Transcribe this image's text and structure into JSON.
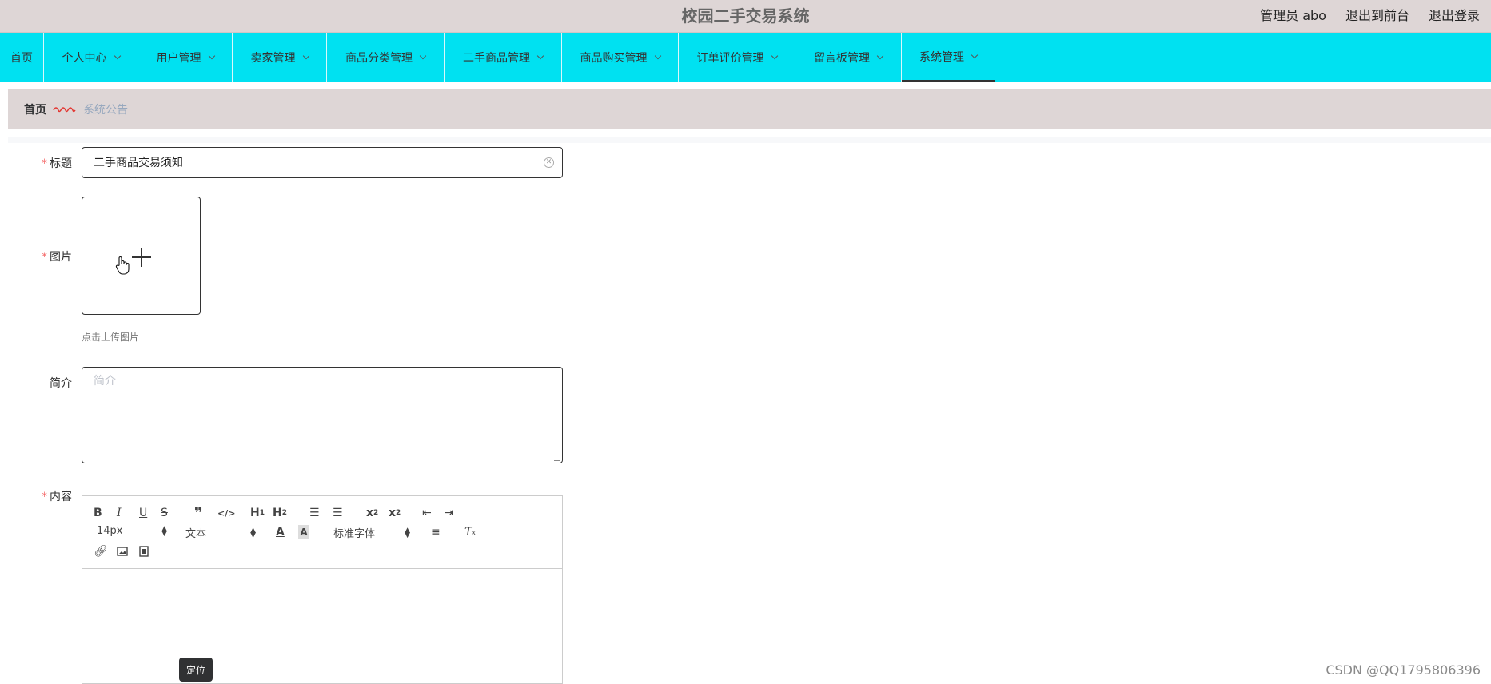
{
  "header": {
    "title": "校园二手交易系统",
    "user_label": "管理员 abo",
    "front_label": "退出到前台",
    "logout_label": "退出登录"
  },
  "nav": {
    "items": [
      {
        "label": "首页",
        "has_menu": false
      },
      {
        "label": "个人中心",
        "has_menu": true
      },
      {
        "label": "用户管理",
        "has_menu": true
      },
      {
        "label": "卖家管理",
        "has_menu": true
      },
      {
        "label": "商品分类管理",
        "has_menu": true
      },
      {
        "label": "二手商品管理",
        "has_menu": true
      },
      {
        "label": "商品购买管理",
        "has_menu": true
      },
      {
        "label": "订单评价管理",
        "has_menu": true
      },
      {
        "label": "留言板管理",
        "has_menu": true
      },
      {
        "label": "系统管理",
        "has_menu": true,
        "active": true
      }
    ],
    "color": "#00e1f1"
  },
  "breadcrumb": {
    "home": "首页",
    "current": "系统公告"
  },
  "form": {
    "title_label": "标题",
    "title_value": "二手商品交易须知",
    "image_label": "图片",
    "upload_tip": "点击上传图片",
    "intro_label": "简介",
    "intro_placeholder": "简介",
    "content_label": "内容"
  },
  "editor": {
    "size_value": "14px",
    "header_value": "文本",
    "font_value": "标准字体"
  },
  "tooltip": "定位",
  "watermark": "CSDN @QQ1795806396"
}
